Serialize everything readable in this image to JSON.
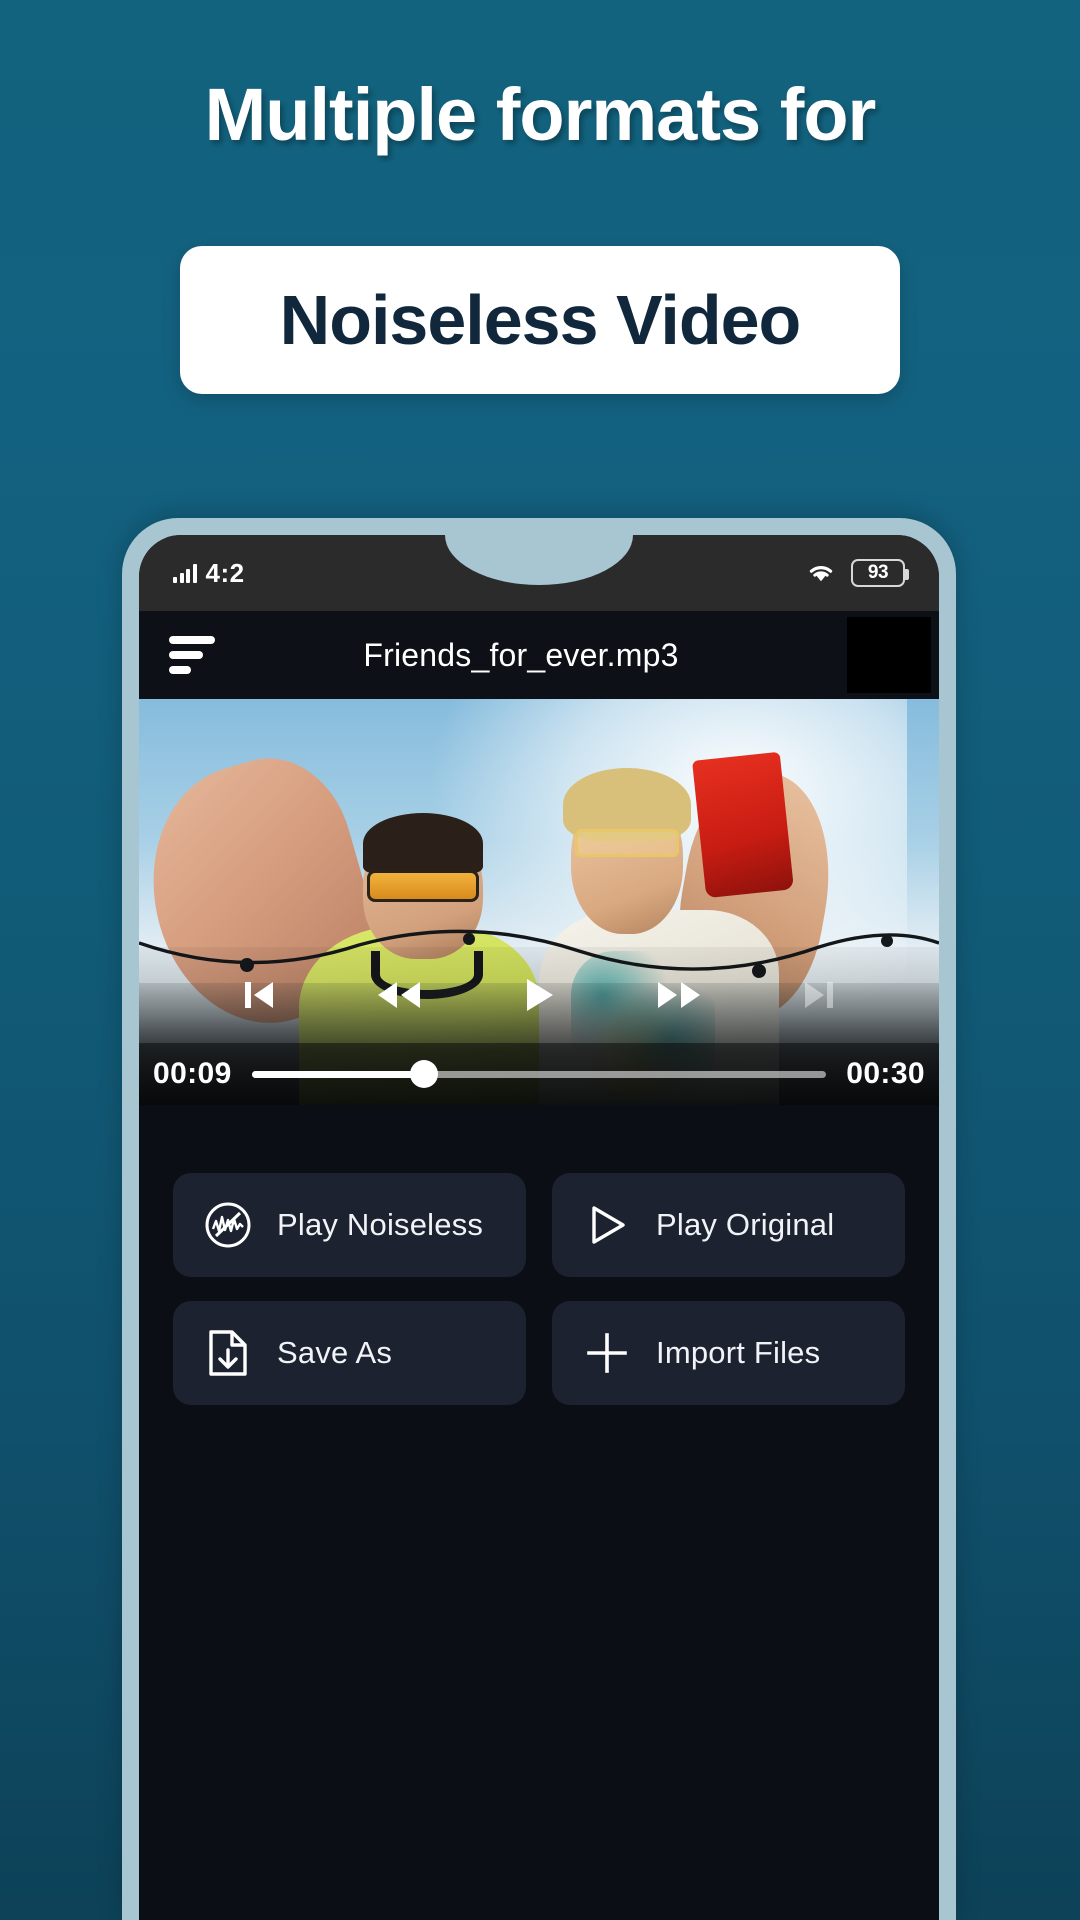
{
  "promo": {
    "headline": "Multiple formats for",
    "card_text": "Noiseless Video",
    "bg_color": "#12637e",
    "card_bg": "#ffffff",
    "card_text_color": "#11283c"
  },
  "phone": {
    "frame_color": "#a8c5d2",
    "screen_bg": "#0b0e14"
  },
  "status_bar": {
    "time": "4:2",
    "signal_icon": "signal-bars-icon",
    "wifi_icon": "wifi-icon",
    "battery_level": "93",
    "battery_icon": "battery-icon"
  },
  "app_bar": {
    "menu_icon": "hamburger-menu-icon",
    "title": "Friends_for_ever.mp3",
    "thumbnail": "video-thumbnail"
  },
  "player": {
    "controls": [
      {
        "name": "previous-track-button",
        "icon": "skip-previous-icon",
        "dimmed": false
      },
      {
        "name": "rewind-button",
        "icon": "rewind-icon",
        "dimmed": false
      },
      {
        "name": "play-button",
        "icon": "play-icon",
        "dimmed": false
      },
      {
        "name": "fast-forward-button",
        "icon": "fast-forward-icon",
        "dimmed": false
      },
      {
        "name": "next-track-button",
        "icon": "skip-next-icon",
        "dimmed": true
      }
    ],
    "current_time": "00:09",
    "total_time": "00:30",
    "progress_percent": 30
  },
  "actions": [
    {
      "label": "Play Noiseless",
      "icon": "noiseless-waveform-icon"
    },
    {
      "label": "Play Original",
      "icon": "play-outline-icon"
    },
    {
      "label": "Save As",
      "icon": "file-download-icon"
    },
    {
      "label": "Import Files",
      "icon": "plus-icon"
    }
  ]
}
